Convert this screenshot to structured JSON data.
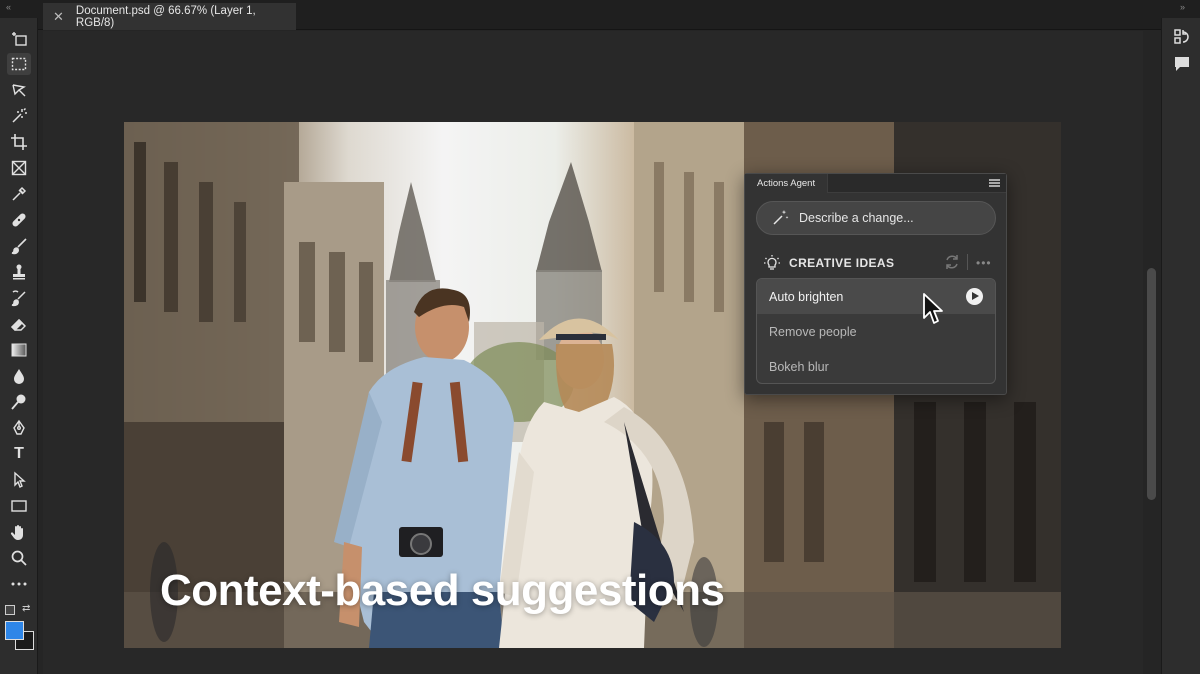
{
  "document_tab": {
    "title": "Document.psd @ 66.67% (Layer 1, RGB/8)",
    "close_glyph": "✕"
  },
  "toolbar": {
    "tools": [
      {
        "name": "artboard-tool-icon",
        "active": false
      },
      {
        "name": "rectangular-marquee-tool-icon",
        "active": true
      },
      {
        "name": "lasso-tool-icon",
        "active": false
      },
      {
        "name": "magic-wand-tool-icon",
        "active": false
      },
      {
        "name": "crop-tool-icon",
        "active": false
      },
      {
        "name": "frame-tool-icon",
        "active": false
      },
      {
        "name": "eyedropper-tool-icon",
        "active": false
      },
      {
        "name": "healing-brush-tool-icon",
        "active": false
      },
      {
        "name": "brush-tool-icon",
        "active": false
      },
      {
        "name": "clone-stamp-tool-icon",
        "active": false
      },
      {
        "name": "history-brush-tool-icon",
        "active": false
      },
      {
        "name": "eraser-tool-icon",
        "active": false
      },
      {
        "name": "gradient-tool-icon",
        "active": false
      },
      {
        "name": "blur-tool-icon",
        "active": false
      },
      {
        "name": "dodge-tool-icon",
        "active": false
      },
      {
        "name": "pen-tool-icon",
        "active": false
      },
      {
        "name": "type-tool-icon",
        "active": false
      },
      {
        "name": "path-selection-tool-icon",
        "active": false
      },
      {
        "name": "rectangle-tool-icon",
        "active": false
      },
      {
        "name": "hand-tool-icon",
        "active": false
      },
      {
        "name": "zoom-tool-icon",
        "active": false
      },
      {
        "name": "more-tools-icon",
        "active": false
      }
    ],
    "type_tool_letter": "T",
    "foreground_color": "#2e86e8",
    "background_color": "#1b1b1b"
  },
  "canvas": {
    "caption": "Context-based suggestions"
  },
  "actions_agent": {
    "panel_title": "Actions Agent",
    "describe_placeholder": "Describe a change...",
    "creative_ideas_heading": "CREATIVE IDEAS",
    "more_glyph": "•••",
    "ideas": [
      {
        "label": "Auto brighten",
        "hovered": true
      },
      {
        "label": "Remove people",
        "hovered": false
      },
      {
        "label": "Bokeh blur",
        "hovered": false
      }
    ]
  },
  "right_panel": {
    "icons": [
      "history-icon",
      "comments-icon"
    ]
  }
}
